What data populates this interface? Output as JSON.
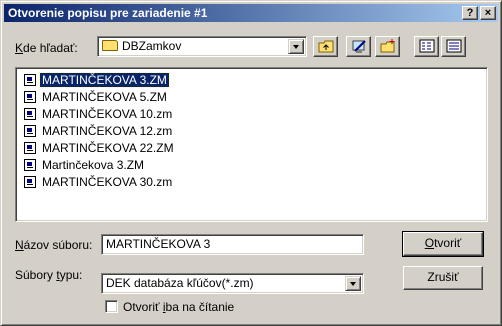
{
  "window": {
    "title": "Otvorenie popisu pre zariadenie #1",
    "help_button": "?",
    "close_button": "×"
  },
  "look_in": {
    "label_accel": "K",
    "label_rest": "de hľadať:",
    "value": "DBZamkov"
  },
  "toolbar": {
    "buttons": [
      "up-folder-icon",
      "desktop-icon",
      "new-folder-icon",
      "list-view-icon",
      "details-view-icon"
    ]
  },
  "files": [
    {
      "name": "MARTINČEKOVA  3.ZM",
      "selected": true
    },
    {
      "name": "MARTINČEKOVA  5.ZM"
    },
    {
      "name": "MARTINČEKOVA 10.zm"
    },
    {
      "name": "MARTINČEKOVA 12.zm"
    },
    {
      "name": "MARTINČEKOVA 22.ZM"
    },
    {
      "name": "Martinčekova 3.ZM"
    },
    {
      "name": "MARTINČEKOVA 30.zm"
    }
  ],
  "file_name": {
    "label_accel": "N",
    "label_rest": "ázov súboru:",
    "value": "MARTINČEKOVA  3"
  },
  "file_type": {
    "label_pre": "Súbory ",
    "label_accel": "t",
    "label_rest": "ypu:",
    "value": "DEK databáza kľúčov(*.zm)"
  },
  "buttons": {
    "open_accel": "O",
    "open_rest": "tvoriť",
    "cancel": "Zrušiť"
  },
  "readonly": {
    "label_pre": "Otvoriť ",
    "label_accel": "i",
    "label_rest": "ba na čítanie",
    "checked": false
  },
  "colors": {
    "title_start": "#0a246a",
    "title_end": "#a6caf0",
    "selection": "#0a246a",
    "face": "#d4d0c8"
  }
}
